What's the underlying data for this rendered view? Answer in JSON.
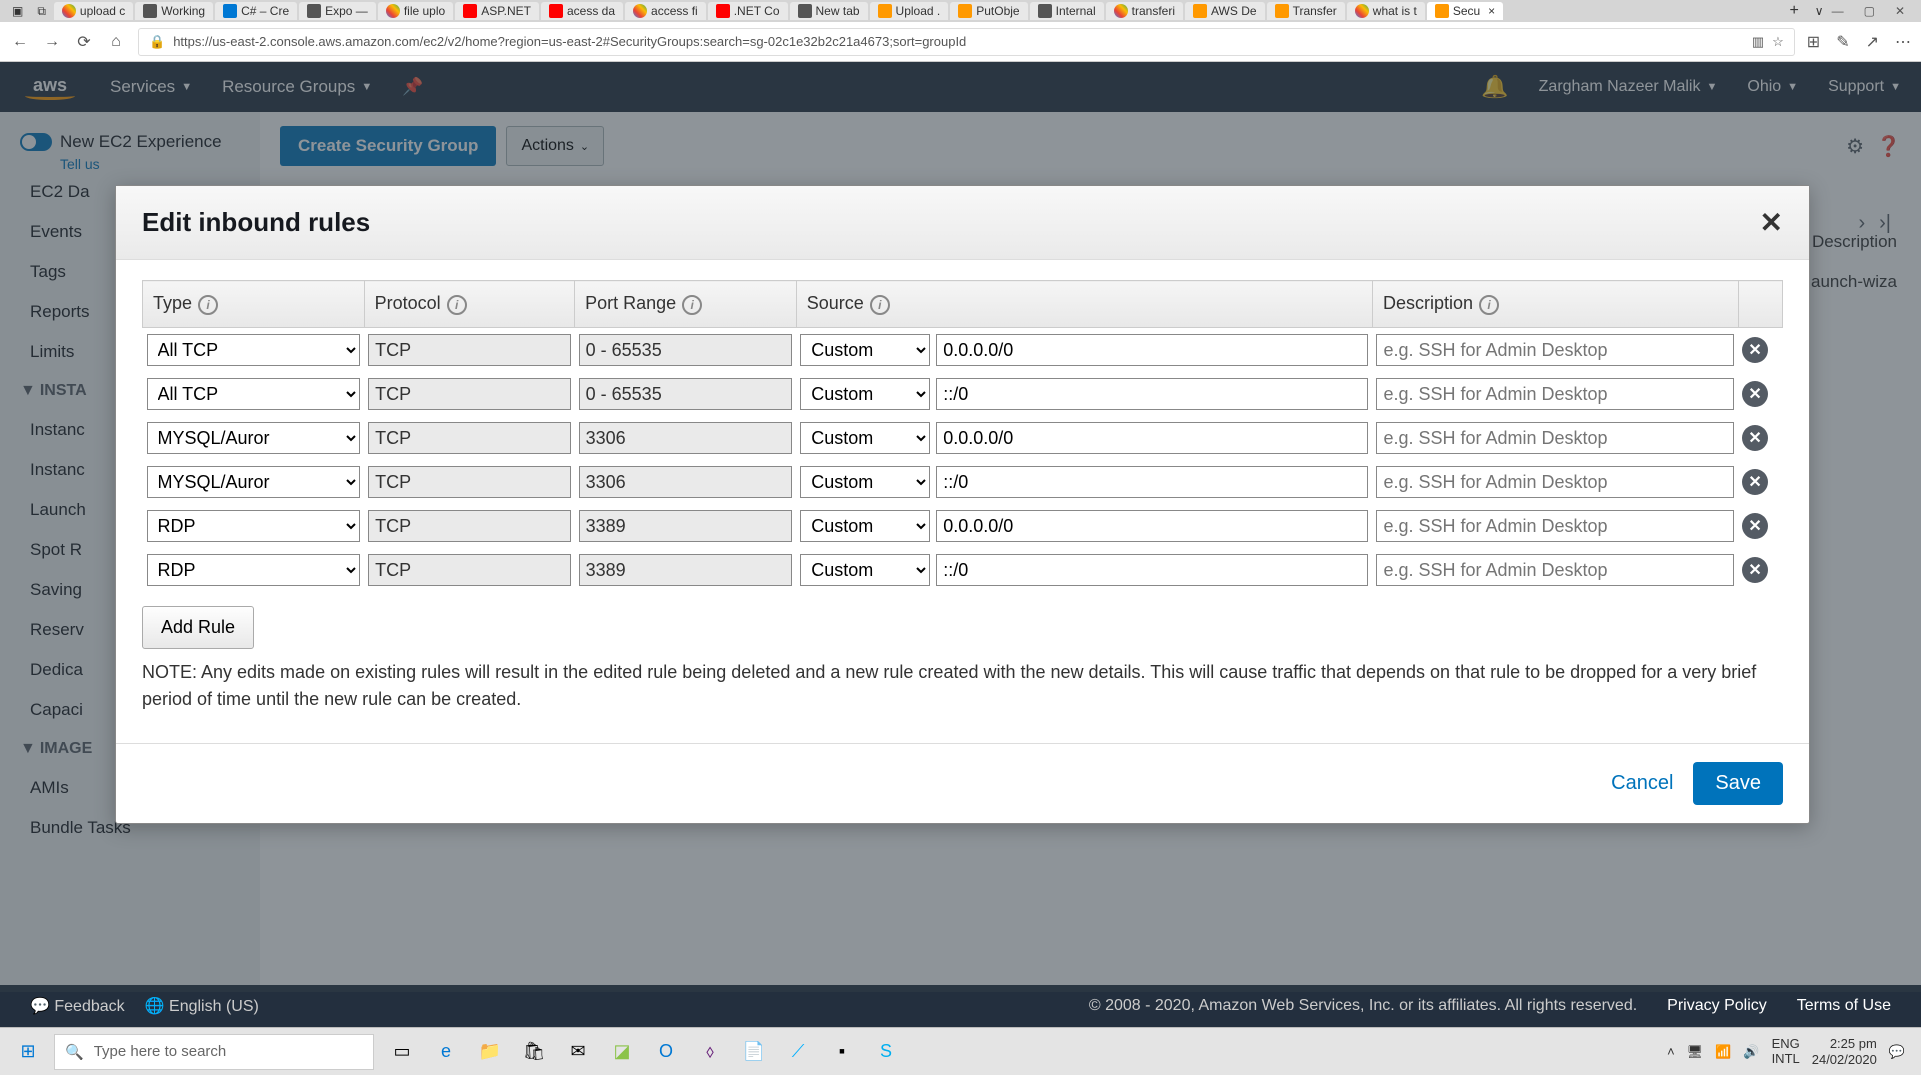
{
  "browser": {
    "tabs": [
      {
        "label": "upload c",
        "fav": "fg"
      },
      {
        "label": "Working",
        "fav": "fk"
      },
      {
        "label": "C# – Cre",
        "fav": "fb"
      },
      {
        "label": "Expo —",
        "fav": "fk"
      },
      {
        "label": "file uplo",
        "fav": "fg"
      },
      {
        "label": "ASP.NET",
        "fav": "fy"
      },
      {
        "label": "acess da",
        "fav": "fy"
      },
      {
        "label": "access fi",
        "fav": "fg"
      },
      {
        "label": ".NET Co",
        "fav": "fy"
      },
      {
        "label": "New tab",
        "fav": "fk"
      },
      {
        "label": "Upload .",
        "fav": "fo"
      },
      {
        "label": "PutObje",
        "fav": "fo"
      },
      {
        "label": "Internal",
        "fav": "fk"
      },
      {
        "label": "transferi",
        "fav": "fg"
      },
      {
        "label": "AWS De",
        "fav": "fo"
      },
      {
        "label": "Transfer",
        "fav": "fo"
      },
      {
        "label": "what is t",
        "fav": "fg"
      },
      {
        "label": "Secu",
        "fav": "fo",
        "active": true
      }
    ],
    "url": "https://us-east-2.console.aws.amazon.com/ec2/v2/home?region=us-east-2#SecurityGroups:search=sg-02c1e32b2c21a4673;sort=groupId"
  },
  "aws_header": {
    "services": "Services",
    "resource_groups": "Resource Groups",
    "user": "Zargham Nazeer Malik",
    "region": "Ohio",
    "support": "Support"
  },
  "sidebar": {
    "new_exp": "New EC2 Experience",
    "tell_us": "Tell us",
    "items": [
      "EC2 Da",
      "Events",
      "Tags",
      "Reports",
      "Limits"
    ],
    "section_instances": "INSTA",
    "inst_items": [
      "Instanc",
      "Instanc",
      "Launch",
      "Spot R",
      "Saving",
      "Reserv",
      "Dedica",
      "Capaci"
    ],
    "section_images": "IMAGE",
    "img_items": [
      "AMIs",
      "Bundle Tasks"
    ]
  },
  "toolbar": {
    "create": "Create Security Group",
    "actions": "Actions"
  },
  "background_table": {
    "desc_header": "Description",
    "row1": "aunch-wiza"
  },
  "modal": {
    "title": "Edit inbound rules",
    "headers": {
      "type": "Type",
      "protocol": "Protocol",
      "port": "Port Range",
      "source": "Source",
      "description": "Description"
    },
    "rules": [
      {
        "type": "All TCP",
        "protocol": "TCP",
        "port": "0 - 65535",
        "source_mode": "Custom",
        "source_val": "0.0.0.0/0"
      },
      {
        "type": "All TCP",
        "protocol": "TCP",
        "port": "0 - 65535",
        "source_mode": "Custom",
        "source_val": "::/0"
      },
      {
        "type": "MYSQL/Auror",
        "protocol": "TCP",
        "port": "3306",
        "source_mode": "Custom",
        "source_val": "0.0.0.0/0"
      },
      {
        "type": "MYSQL/Auror",
        "protocol": "TCP",
        "port": "3306",
        "source_mode": "Custom",
        "source_val": "::/0"
      },
      {
        "type": "RDP",
        "protocol": "TCP",
        "port": "3389",
        "source_mode": "Custom",
        "source_val": "0.0.0.0/0"
      },
      {
        "type": "RDP",
        "protocol": "TCP",
        "port": "3389",
        "source_mode": "Custom",
        "source_val": "::/0"
      }
    ],
    "desc_placeholder": "e.g. SSH for Admin Desktop",
    "add_rule": "Add Rule",
    "note": "NOTE: Any edits made on existing rules will result in the edited rule being deleted and a new rule created with the new details. This will cause traffic that depends on that rule to be dropped for a very brief period of time until the new rule can be created.",
    "cancel": "Cancel",
    "save": "Save"
  },
  "footer": {
    "feedback": "Feedback",
    "lang": "English (US)",
    "copyright": "© 2008 - 2020, Amazon Web Services, Inc. or its affiliates. All rights reserved.",
    "privacy": "Privacy Policy",
    "terms": "Terms of Use"
  },
  "taskbar": {
    "search_placeholder": "Type here to search",
    "lang1": "ENG",
    "lang2": "INTL",
    "time": "2:25 pm",
    "date": "24/02/2020"
  }
}
